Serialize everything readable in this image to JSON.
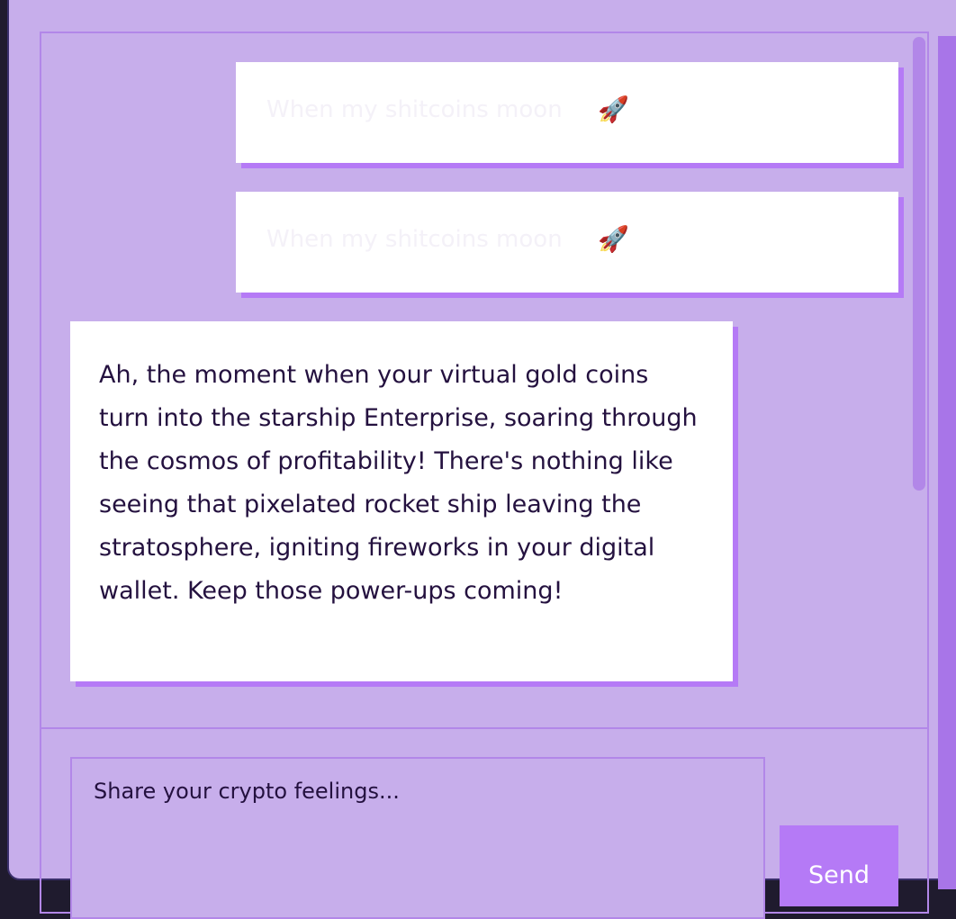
{
  "messages": [
    {
      "role": "user",
      "text": "When my shitcoins moon",
      "emoji": "🚀"
    },
    {
      "role": "user",
      "text": "When my shitcoins moon",
      "emoji": "🚀"
    },
    {
      "role": "assistant",
      "text": "Ah, the moment when your virtual gold coins turn into the starship Enterprise, soaring through the cosmos of profitability! There's nothing like seeing that pixelated rocket ship leaving the stratosphere, igniting fireworks in your digital wallet. Keep those power-ups coming!"
    }
  ],
  "composer": {
    "placeholder": "Share your crypto feelings...",
    "value": "",
    "send_label": "Send"
  },
  "colors": {
    "background": "#c7aeeb",
    "accent": "#b57af6",
    "bubble": "#ffffff",
    "text": "#24113f"
  }
}
